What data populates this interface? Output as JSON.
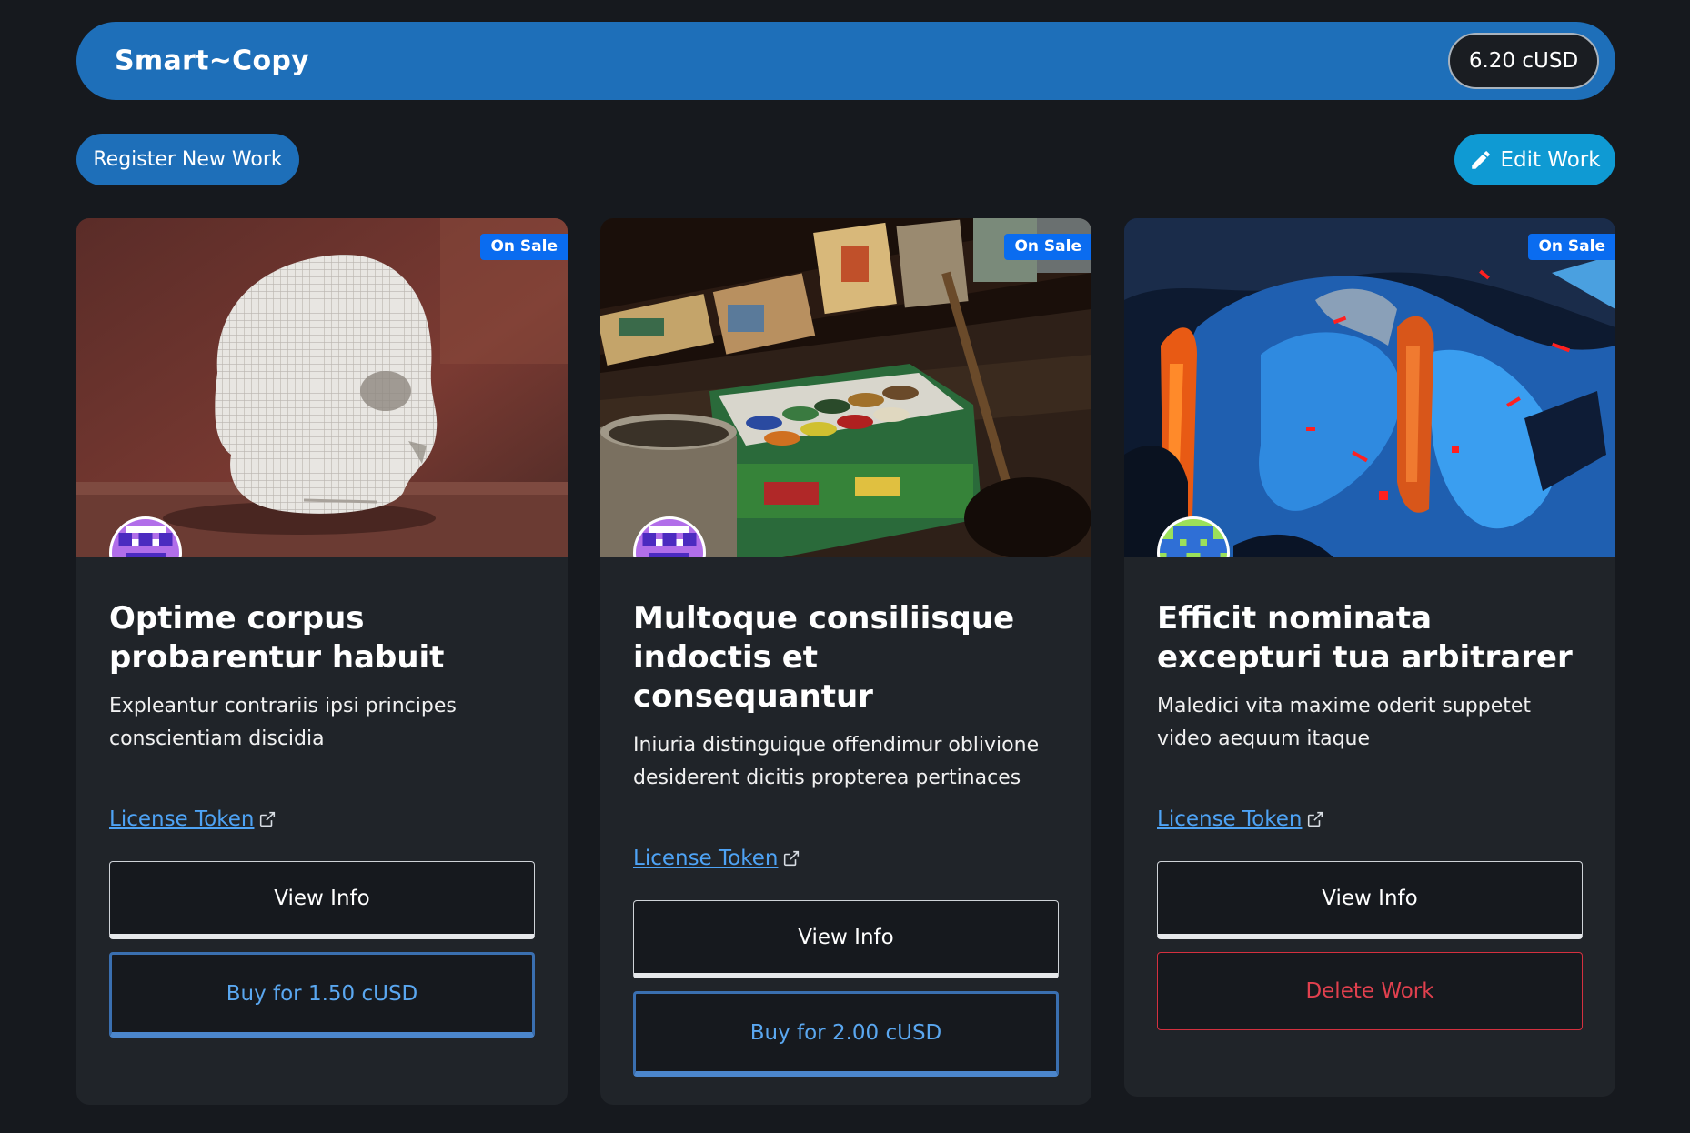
{
  "header": {
    "brand": "Smart~Copy",
    "balance": "6.20 cUSD"
  },
  "toolbar": {
    "register_label": "Register New Work",
    "edit_label": "Edit Work"
  },
  "cards": [
    {
      "badge": "On Sale",
      "title": "Optime corpus probarentur habuit",
      "description": "Expleantur contrariis ipsi principes conscientiam discidia",
      "license_label": "License Token",
      "view_label": "View Info",
      "action_label": "Buy for 1.50 cUSD"
    },
    {
      "badge": "On Sale",
      "title": "Multoque consiliisque indoctis et consequantur",
      "description": "Iniuria distinguique offendimur oblivione desiderent dicitis propterea pertinaces",
      "license_label": "License Token",
      "view_label": "View Info",
      "action_label": "Buy for 2.00 cUSD"
    },
    {
      "badge": "On Sale",
      "title": "Efficit nominata excepturi tua arbitrarer",
      "description": "Maledici vita maxime oderit suppetet video aequum itaque",
      "license_label": "License Token",
      "view_label": "View Info",
      "action_label": "Delete Work"
    }
  ],
  "icons": {
    "edit": "pencil-icon",
    "license": "external-link-icon"
  },
  "colors": {
    "background": "#16191e",
    "primary": "#1e6fb9",
    "edit_button": "#0f9ad3",
    "badge": "#0a6cf0",
    "card": "#202429",
    "link": "#4ea3f5",
    "danger": "#d4303f"
  }
}
